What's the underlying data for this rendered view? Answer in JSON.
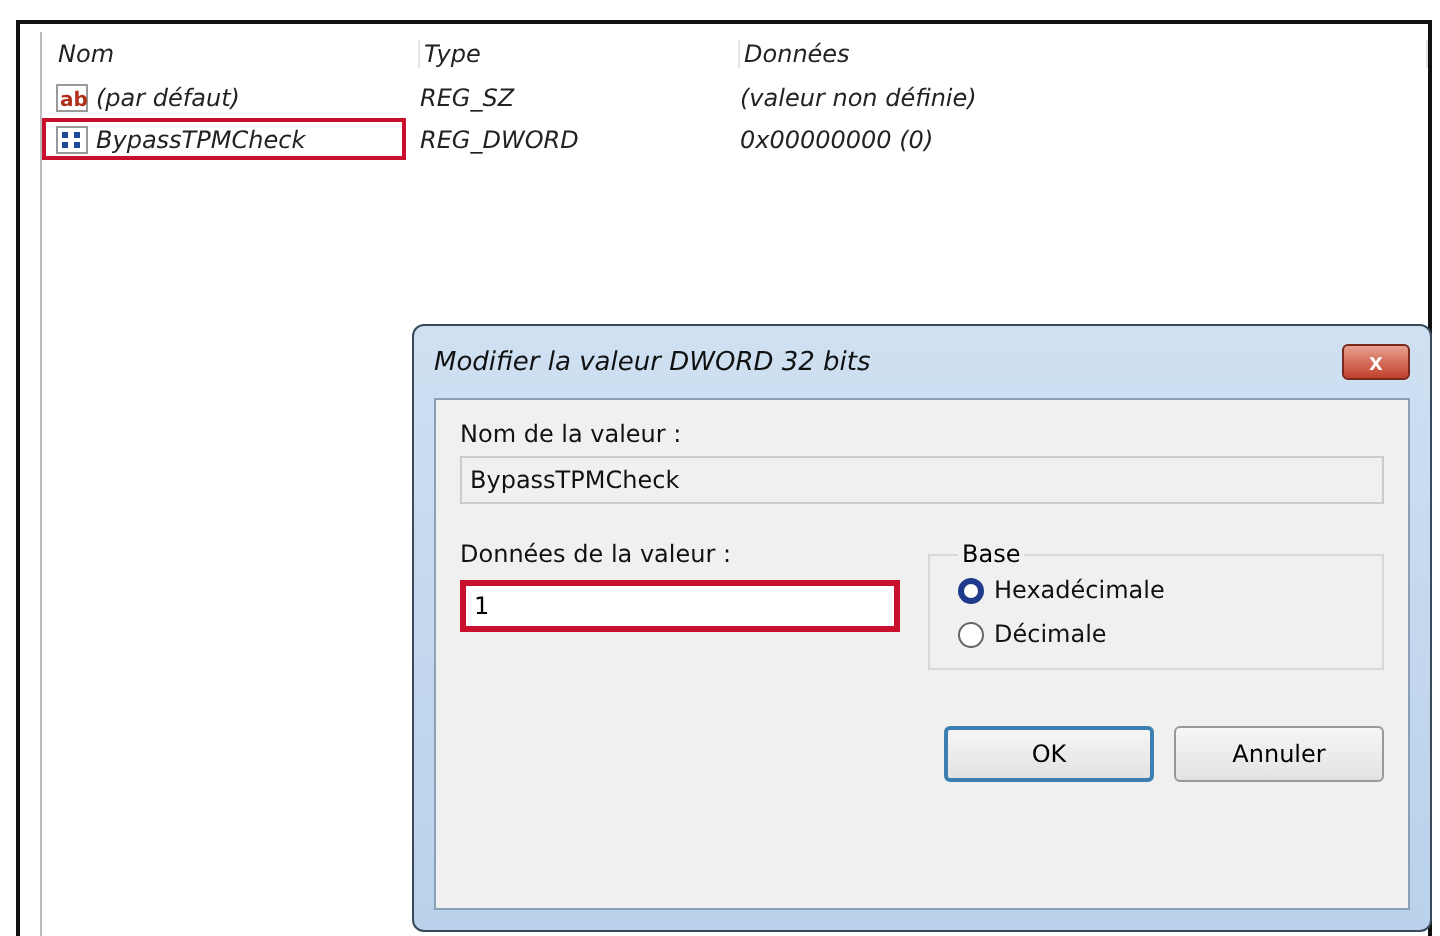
{
  "list": {
    "columns": [
      "Nom",
      "Type",
      "Données"
    ],
    "rows": [
      {
        "kind": "string",
        "icon_text": "ab",
        "name": "(par défaut)",
        "type": "REG_SZ",
        "data": "(valeur non définie)",
        "highlighted": false
      },
      {
        "kind": "binary",
        "name": "BypassTPMCheck",
        "type": "REG_DWORD",
        "data": "0x00000000 (0)",
        "highlighted": true
      }
    ]
  },
  "dialog": {
    "title": "Modifier la valeur DWORD 32 bits",
    "close": "x",
    "name_label": "Nom de la valeur :",
    "name_value": "BypassTPMCheck",
    "data_label": "Données de la valeur :",
    "data_value": "1",
    "data_highlighted": true,
    "base": {
      "title": "Base",
      "options": [
        {
          "label": "Hexadécimale",
          "selected": true
        },
        {
          "label": "Décimale",
          "selected": false
        }
      ]
    },
    "buttons": [
      {
        "label": "OK",
        "default": true
      },
      {
        "label": "Annuler",
        "default": false
      }
    ]
  }
}
